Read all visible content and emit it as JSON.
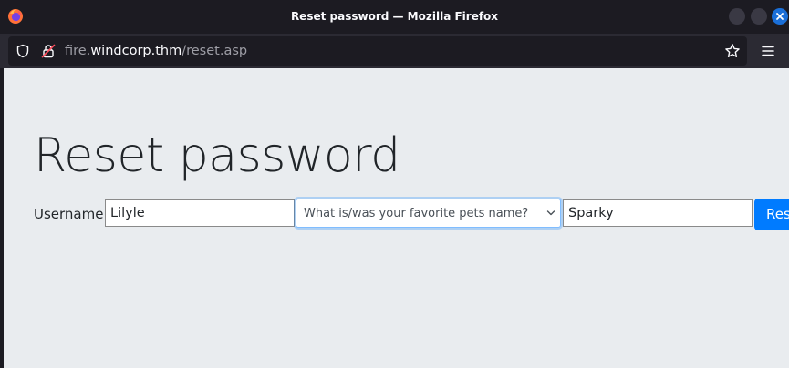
{
  "window": {
    "title": "Reset password — Mozilla Firefox"
  },
  "toolbar": {
    "url_subdomain": "fire.",
    "url_domain": "windcorp.thm",
    "url_path": "/reset.asp"
  },
  "icons": {
    "browser_logo": "firefox-icon",
    "tracking_protection": "shield-icon",
    "connection": "lock-icon",
    "bookmark": "star-icon",
    "menu": "hamburger-menu-icon",
    "select_arrow": "chevron-down-icon",
    "close": "close-icon"
  },
  "page": {
    "title": "Reset password",
    "form": {
      "username_label": "Username:",
      "username_value": "Lilyle",
      "question_selected": "What is/was your favorite pets name?",
      "answer_value": "Sparky",
      "submit_label": "Reset"
    }
  },
  "colors": {
    "page_background": "#e9ecef",
    "primary_button": "#007bff",
    "close_button": "#1a6fd8",
    "chrome_dark": "#1c1b22",
    "toolbar": "#2b2a33"
  }
}
